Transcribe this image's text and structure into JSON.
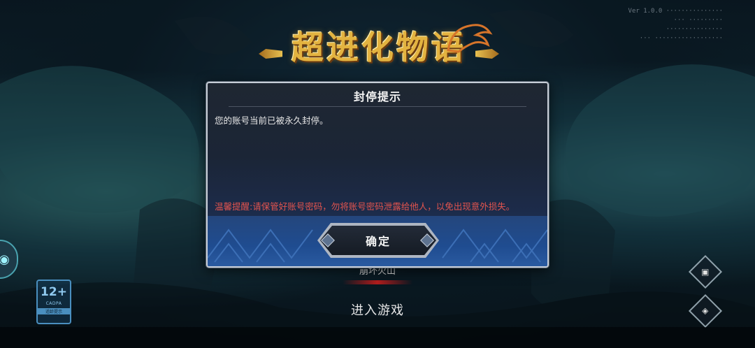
{
  "game": {
    "logo_text": "超进化物语"
  },
  "version_lines": [
    "Ver 1.0.0 ···············",
    "··· ·········",
    "···············",
    "··· ··················"
  ],
  "menu": {
    "server_name": "崩坏火山",
    "enter_label": "进入游戏",
    "age_rating": {
      "label": "12+",
      "sub": "CADPA",
      "note": "适龄提示"
    }
  },
  "dialog": {
    "title": "封停提示",
    "message": "您的账号当前已被永久封停。",
    "warning": "温馨提醒:请保管好账号密码，勿将账号密码泄露给他人，以免出现意外损失。",
    "confirm_label": "确定"
  },
  "colors": {
    "warning_text": "#e2544e",
    "dialog_border": "#c7ced7",
    "logo_gold": "#e3b340"
  }
}
